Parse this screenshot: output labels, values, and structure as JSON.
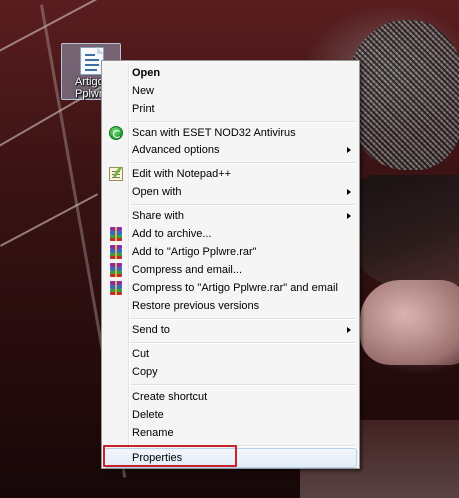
{
  "desktop": {
    "icon": {
      "name_line1": "Artigo",
      "name_line2": "Pplwre",
      "icon": "text-document-icon"
    }
  },
  "context_menu": {
    "items": [
      {
        "label": "Open",
        "bold": true
      },
      {
        "label": "New"
      },
      {
        "label": "Print"
      },
      {
        "label": "Scan with ESET NOD32 Antivirus",
        "icon": "eset-icon"
      },
      {
        "label": "Advanced options",
        "submenu": true
      },
      {
        "label": "Edit with Notepad++",
        "icon": "notepad-plus-plus-icon"
      },
      {
        "label": "Open with",
        "submenu": true
      },
      {
        "label": "Share with",
        "submenu": true
      },
      {
        "label": "Add to archive...",
        "icon": "winrar-icon"
      },
      {
        "label": "Add to \"Artigo Pplwre.rar\"",
        "icon": "winrar-icon"
      },
      {
        "label": "Compress and email...",
        "icon": "winrar-icon"
      },
      {
        "label": "Compress to \"Artigo Pplwre.rar\" and email",
        "icon": "winrar-icon"
      },
      {
        "label": "Restore previous versions"
      },
      {
        "label": "Send to",
        "submenu": true
      },
      {
        "label": "Cut"
      },
      {
        "label": "Copy"
      },
      {
        "label": "Create shortcut"
      },
      {
        "label": "Delete"
      },
      {
        "label": "Rename"
      },
      {
        "label": "Properties",
        "highlighted": true
      }
    ]
  },
  "colors": {
    "highlight_box": "#c8232c",
    "menu_background": "#f5f5f5",
    "hover_border": "#b8cfe9"
  }
}
